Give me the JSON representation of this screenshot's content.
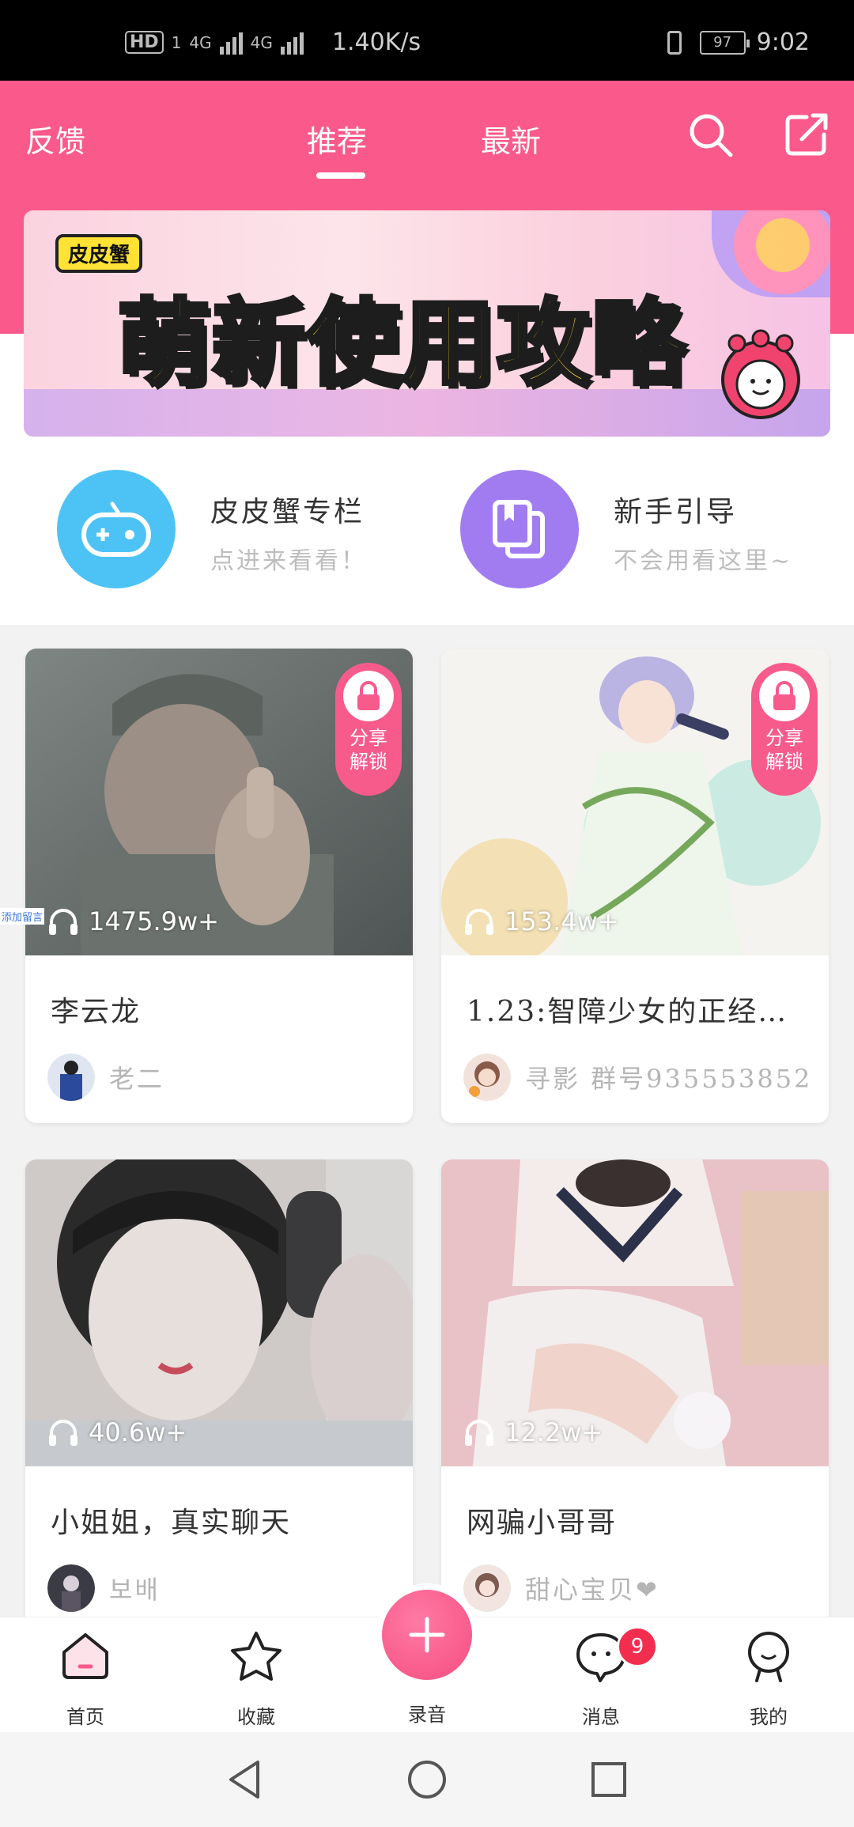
{
  "status_bar": {
    "hd": "HD",
    "sim": "1",
    "net1": "4G",
    "net2": "4G",
    "speed": "1.40K/s",
    "battery": "97",
    "time": "9:02"
  },
  "header": {
    "feedback": "反馈",
    "tab_recommend": "推荐",
    "tab_latest": "最新",
    "active_tab": "推荐"
  },
  "banner": {
    "badge": "皮皮蟹",
    "title": "萌新使用攻略"
  },
  "entries": [
    {
      "title": "皮皮蟹专栏",
      "subtitle": "点进来看看！",
      "color": "#4dc3f5"
    },
    {
      "title": "新手引导",
      "subtitle": "不会用看这里~",
      "color": "#a07cf0"
    }
  ],
  "side_tag": "添加留言",
  "cards": [
    {
      "title": "李云龙",
      "plays": "1475.9w+",
      "author": "老二",
      "locked": true,
      "lock_text": "分享\n解锁"
    },
    {
      "title": "1.23:智障少女的正经…",
      "plays": "153.4w+",
      "author": "寻影   群号935553852",
      "locked": true,
      "lock_text": "分享\n解锁"
    },
    {
      "title": "小姐姐，真实聊天",
      "plays": "40.6w+",
      "author": "보배",
      "locked": false
    },
    {
      "title": "网骗小哥哥",
      "plays": "12.2w+",
      "author": "甜心宝贝❤",
      "locked": false
    }
  ],
  "lock": {
    "line1": "分享",
    "line2": "解锁"
  },
  "tabbar": {
    "home": "首页",
    "favorites": "收藏",
    "record": "录音",
    "messages": "消息",
    "messages_badge": "9",
    "mine": "我的"
  },
  "colors": {
    "accent": "#fa5a8b",
    "badge": "#f22d4e"
  }
}
